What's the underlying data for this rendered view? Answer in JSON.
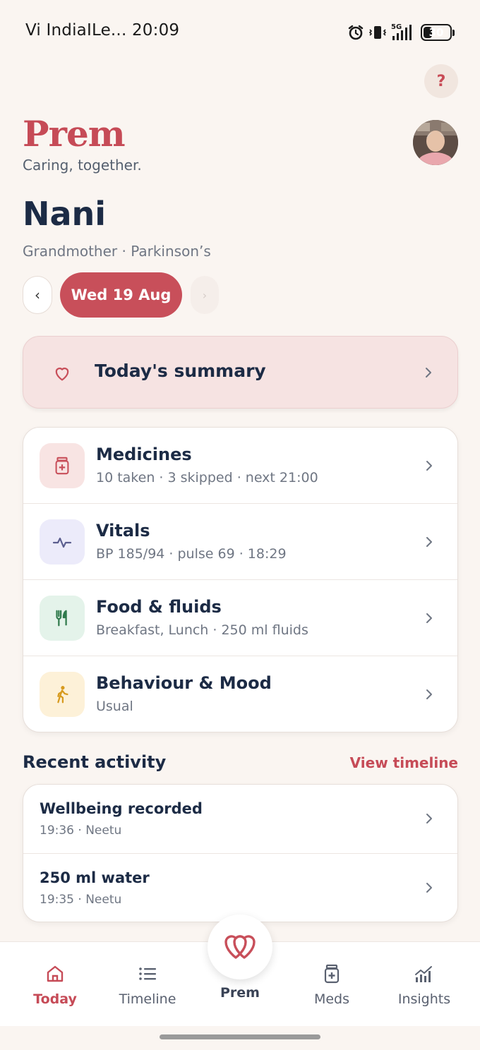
{
  "status_bar": {
    "carrier_time": "Vi IndiaILe... 20:09",
    "network": "5G",
    "battery": "30",
    "battery_level": 0.3
  },
  "header": {
    "help_label": "?",
    "brand": "Prem",
    "tagline": "Caring, together."
  },
  "profile": {
    "name": "Nani",
    "relation": "Grandmother",
    "condition": "Parkinson’s",
    "separator": " · "
  },
  "date_nav": {
    "prev_label": "‹",
    "current": "Wed 19 Aug",
    "next_label": "›"
  },
  "summary": {
    "label": "Today's summary",
    "icon": "heart-outline-icon"
  },
  "categories": [
    {
      "title": "Medicines",
      "subtitle": "10 taken · 3 skipped · next 21:00",
      "icon": "medicine-bottle-icon",
      "icon_bg": "#F8E4E3",
      "icon_color": "#C84F5A"
    },
    {
      "title": "Vitals",
      "subtitle": "BP 185/94 · pulse 69 · 18:29",
      "icon": "pulse-icon",
      "icon_bg": "#ECEBFA",
      "icon_color": "#5B5E8F"
    },
    {
      "title": "Food & fluids",
      "subtitle": "Breakfast, Lunch · 250 ml fluids",
      "icon": "fork-knife-icon",
      "icon_bg": "#E4F3EA",
      "icon_color": "#2F7A4C"
    },
    {
      "title": "Behaviour & Mood",
      "subtitle": "Usual",
      "icon": "walking-person-icon",
      "icon_bg": "#FDF1D8",
      "icon_color": "#D79A1E"
    }
  ],
  "recent_activity": {
    "title": "Recent activity",
    "link": "View timeline",
    "items": [
      {
        "title": "Wellbeing recorded",
        "subtitle": "19:36 · Neetu"
      },
      {
        "title": "250 ml water",
        "subtitle": "19:35 · Neetu"
      }
    ]
  },
  "bottom_nav": {
    "items": [
      {
        "label": "Today",
        "icon": "home-icon",
        "active": true
      },
      {
        "label": "Timeline",
        "icon": "list-icon",
        "active": false
      },
      {
        "label": "Meds",
        "icon": "medicine-bottle-icon",
        "active": false
      },
      {
        "label": "Insights",
        "icon": "chart-icon",
        "active": false
      }
    ],
    "center": {
      "label": "Prem",
      "icon": "double-heart-logo-icon"
    }
  },
  "colors": {
    "accent": "#C64B57",
    "background": "#FAF5F1",
    "text_primary": "#1C2B45",
    "text_secondary": "#6F7683"
  }
}
